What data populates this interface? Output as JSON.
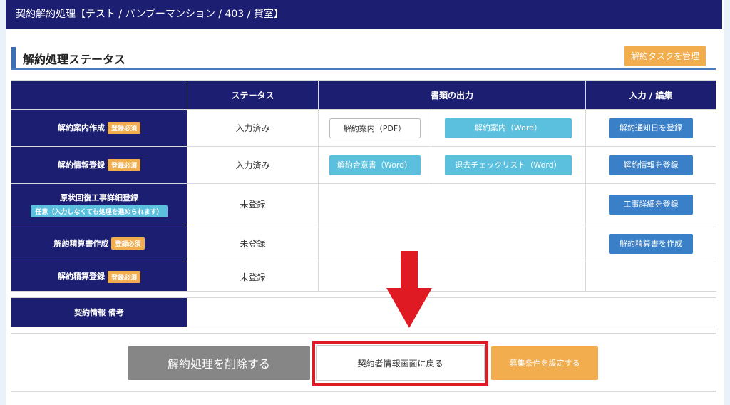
{
  "titlebar": {
    "text": "契約解約処理【テスト / バンブーマンション / 403 / 貸室】"
  },
  "section": {
    "title": "解約処理ステータス",
    "task_button": "解約タスクを管理"
  },
  "table": {
    "headers": [
      "",
      "ステータス",
      "書類の出力",
      "入力 / 編集"
    ],
    "rows": [
      {
        "label": "解約案内作成",
        "badge": "登録必須",
        "status": "入力済み",
        "outputs": [
          "解約案内（PDF）",
          "解約案内（Word）"
        ],
        "action": "解約通知日を登録"
      },
      {
        "label": "解約情報登録",
        "badge": "登録必須",
        "status": "入力済み",
        "outputs": [
          "解約合意書（Word）",
          "退去チェックリスト（Word）"
        ],
        "action": "解約情報を登録"
      },
      {
        "label": "原状回復工事詳細登録",
        "note": "任意（入力しなくても処理を進められます）",
        "status": "未登録",
        "outputs": [],
        "action": "工事詳細を登録"
      },
      {
        "label": "解約精算書作成",
        "badge": "登録必須",
        "status": "未登録",
        "outputs": [],
        "action": "解約精算書を作成"
      },
      {
        "label": "解約精算登録",
        "badge": "登録必須",
        "status": "未登録",
        "outputs": [],
        "action": ""
      }
    ]
  },
  "memo": {
    "label": "契約情報 備考",
    "value": ""
  },
  "footer": {
    "delete_button": "解約処理を削除する",
    "back_button": "契約者情報画面に戻る",
    "recruit_button": "募集条件を設定する"
  },
  "colors": {
    "navy": "#1c1e72",
    "orange": "#f2ad4e",
    "cyan": "#5bc0de",
    "blue": "#3a80c8",
    "highlight_red": "#e01a22"
  }
}
